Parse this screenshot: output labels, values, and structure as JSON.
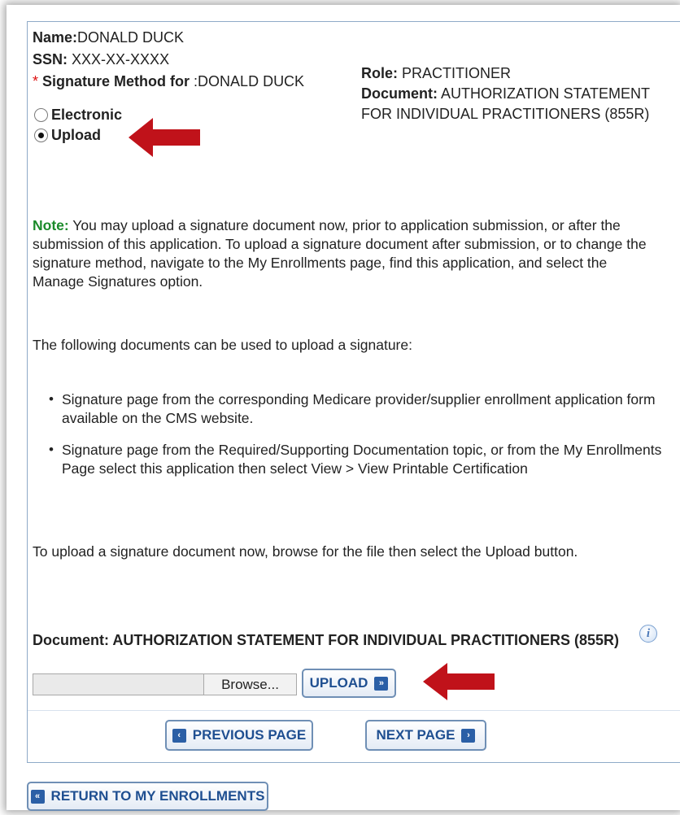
{
  "applicant": {
    "name_label": "Name:",
    "name_value": "DONALD DUCK",
    "ssn_label": "SSN:",
    "ssn_value": "XXX-XX-XXXX",
    "required_mark": "*",
    "sig_method_label": "Signature Method for",
    "sig_method_value": ":DONALD DUCK",
    "role_label": "Role:",
    "role_value": "PRACTITIONER",
    "document_label": "Document:",
    "document_value_line1": "AUTHORIZATION STATEMENT",
    "document_value_line2": "FOR INDIVIDUAL PRACTITIONERS (855R)"
  },
  "signature_method": {
    "options": [
      {
        "label": "Electronic",
        "selected": false
      },
      {
        "label": "Upload",
        "selected": true
      }
    ]
  },
  "note": {
    "label": "Note:",
    "text": " You may upload a signature document now, prior to application submission, or after the submission of this application. To upload a signature document after submission, or to change the signature method, navigate to the My Enrollments page, find this application, and select the Manage Signatures option."
  },
  "documents_intro": "The following documents can be used to upload a signature:",
  "documents_list": [
    "Signature page from the corresponding Medicare provider/supplier enrollment application form available on the CMS website.",
    "Signature page from the Required/Supporting Documentation topic, or from the My Enrollments Page select this application then select View > View Printable Certification"
  ],
  "upload_instructions": "To upload a signature document now, browse for the file then select the Upload button.",
  "upload_section": {
    "document_heading": "Document: AUTHORIZATION STATEMENT FOR INDIVIDUAL PRACTITIONERS (855R)",
    "info_icon_glyph": "i",
    "browse_label": "Browse...",
    "upload_label": "UPLOAD"
  },
  "navigation": {
    "previous_label": "PREVIOUS PAGE",
    "next_label": "NEXT PAGE",
    "return_label": "RETURN TO MY ENROLLMENTS"
  },
  "colors": {
    "arrow": "#c0121a",
    "button_text": "#1f4f91",
    "button_icon": "#2b5fa6",
    "note_label": "#1a8a2a",
    "required": "#dd1111",
    "panel_border": "#8faac8"
  }
}
